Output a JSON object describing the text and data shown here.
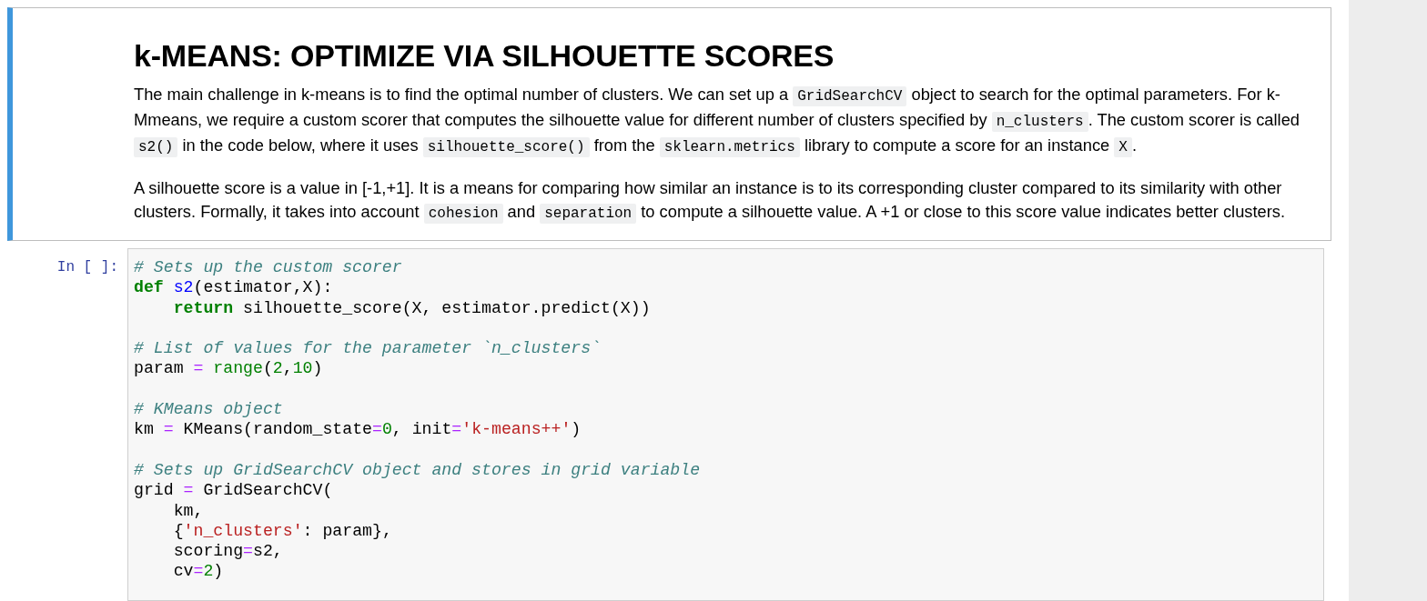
{
  "markdown_cell": {
    "selected": true,
    "heading": "k-MEANS: OPTIMIZE VIA SILHOUETTE SCORES",
    "paragraphs": [
      [
        {
          "kind": "text",
          "text": "The main challenge in k-means is to find the optimal number of clusters. We can set up a "
        },
        {
          "kind": "code",
          "text": "GridSearchCV"
        },
        {
          "kind": "text",
          "text": " object to search for the optimal parameters. For k-Mmeans, we require a custom scorer that computes the silhouette value for different number of clusters specified by "
        },
        {
          "kind": "code",
          "text": "n_clusters"
        },
        {
          "kind": "text",
          "text": ". The custom scorer is called "
        },
        {
          "kind": "code",
          "text": "s2()"
        },
        {
          "kind": "text",
          "text": " in the code below, where it uses "
        },
        {
          "kind": "code",
          "text": "silhouette_score()"
        },
        {
          "kind": "text",
          "text": " from the "
        },
        {
          "kind": "code",
          "text": "sklearn.metrics"
        },
        {
          "kind": "text",
          "text": " library to compute a score for an instance "
        },
        {
          "kind": "code",
          "text": "X"
        },
        {
          "kind": "text",
          "text": "."
        }
      ],
      [
        {
          "kind": "text",
          "text": "A silhouette score is a value in [-1,+1]. It is a means for comparing how similar an instance is to its corresponding cluster compared to its similarity with other clusters. Formally, it takes into account "
        },
        {
          "kind": "code",
          "text": "cohesion"
        },
        {
          "kind": "text",
          "text": " and "
        },
        {
          "kind": "code",
          "text": "separation"
        },
        {
          "kind": "text",
          "text": " to compute a silhouette value. A +1 or close to this score value indicates better clusters."
        }
      ]
    ]
  },
  "code_cell": {
    "prompt": "In [ ]:",
    "blocks": [
      [
        [
          {
            "kind": "comment",
            "text": "# Sets up the custom scorer"
          }
        ],
        [
          {
            "kind": "keyword",
            "text": "def"
          },
          {
            "kind": "funcname",
            "text": " s2"
          },
          {
            "kind": "plain",
            "text": "(estimator,X):"
          }
        ],
        [
          {
            "kind": "keyword",
            "text": "    return"
          },
          {
            "kind": "plain",
            "text": " silhouette_score(X, estimator.predict(X))"
          }
        ]
      ],
      [
        [
          {
            "kind": "comment",
            "text": "# List of values for the parameter `n_clusters`"
          }
        ],
        [
          {
            "kind": "plain",
            "text": "param "
          },
          {
            "kind": "operator",
            "text": "="
          },
          {
            "kind": "builtin",
            "text": " range"
          },
          {
            "kind": "plain",
            "text": "("
          },
          {
            "kind": "number",
            "text": "2"
          },
          {
            "kind": "plain",
            "text": ","
          },
          {
            "kind": "number",
            "text": "10"
          },
          {
            "kind": "plain",
            "text": ")"
          }
        ]
      ],
      [
        [
          {
            "kind": "comment",
            "text": "# KMeans object"
          }
        ],
        [
          {
            "kind": "plain",
            "text": "km "
          },
          {
            "kind": "operator",
            "text": "="
          },
          {
            "kind": "plain",
            "text": " KMeans(random_state"
          },
          {
            "kind": "operator",
            "text": "="
          },
          {
            "kind": "number",
            "text": "0"
          },
          {
            "kind": "plain",
            "text": ", init"
          },
          {
            "kind": "operator",
            "text": "="
          },
          {
            "kind": "string",
            "text": "'k-means++'"
          },
          {
            "kind": "plain",
            "text": ")"
          }
        ]
      ],
      [
        [
          {
            "kind": "comment",
            "text": "# Sets up GridSearchCV object and stores in grid variable"
          }
        ],
        [
          {
            "kind": "plain",
            "text": "grid "
          },
          {
            "kind": "operator",
            "text": "="
          },
          {
            "kind": "plain",
            "text": " GridSearchCV("
          }
        ],
        [
          {
            "kind": "plain",
            "text": "    km,"
          }
        ],
        [
          {
            "kind": "plain",
            "text": "    {"
          },
          {
            "kind": "string",
            "text": "'n_clusters'"
          },
          {
            "kind": "plain",
            "text": ": param},"
          }
        ],
        [
          {
            "kind": "plain",
            "text": "    scoring"
          },
          {
            "kind": "operator",
            "text": "="
          },
          {
            "kind": "plain",
            "text": "s2,"
          }
        ],
        [
          {
            "kind": "plain",
            "text": "    cv"
          },
          {
            "kind": "operator",
            "text": "="
          },
          {
            "kind": "number",
            "text": "2"
          },
          {
            "kind": "plain",
            "text": ")"
          }
        ]
      ]
    ]
  }
}
